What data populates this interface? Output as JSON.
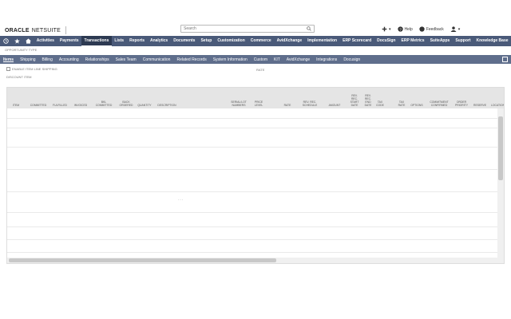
{
  "brand": {
    "oracle": "ORACLE",
    "netsuite": "NETSUITE"
  },
  "search": {
    "placeholder": "Search"
  },
  "user": {
    "help": "Help",
    "feedback": "Feedback"
  },
  "nav": {
    "items": [
      "Activities",
      "Payments",
      "Transactions",
      "Lists",
      "Reports",
      "Analytics",
      "Documents",
      "Setup",
      "Customization",
      "Commerce",
      "AvidXchange",
      "Implementation",
      "ERP Scorecard",
      "DocuSign",
      "ERP Metrics",
      "SuiteApps",
      "Support",
      "Knowledge Base"
    ],
    "active": "Transactions"
  },
  "opportunity_type_label": "OPPORTUNITY TYPE",
  "subtabs": {
    "items": [
      "Items",
      "Shipping",
      "Billing",
      "Accounting",
      "Relationships",
      "Sales Team",
      "Communication",
      "Related Records",
      "System Information",
      "Custom",
      "KIT",
      "AvidXchange",
      "Integrations",
      "Docusign"
    ],
    "active": "Items"
  },
  "form": {
    "enable_line_shipping": "ENABLE ITEM LINE SHIPPING",
    "rate_label": "RATE",
    "discount_item_label": "DISCOUNT ITEM"
  },
  "grid": {
    "columns": [
      "ITEM",
      "COMMITTED",
      "FULFILLED",
      "INVOICED",
      "BKL COMMITTED",
      "BACK ORDERED",
      "QUANTITY",
      "DESCRIPTION",
      "SERIAL/LOT NUMBERS",
      "PRICE LEVEL",
      "RATE",
      "REV. REC. SCHEDULE",
      "AMOUNT",
      "REV. REC. START DATE",
      "REV. REC. END DATE",
      "TAX CODE",
      "TAX RATE",
      "OPTIONS",
      "COMMITMENT CONFIRMED",
      "ORDER PRIORITY",
      "RESERVE",
      "LOCATION"
    ],
    "ellipsis": "- - -",
    "row_count": 11
  },
  "colors": {
    "nav": "#4a5a79",
    "subtabs": "#5f6e8c",
    "grid_header": "#e5e5e5"
  }
}
